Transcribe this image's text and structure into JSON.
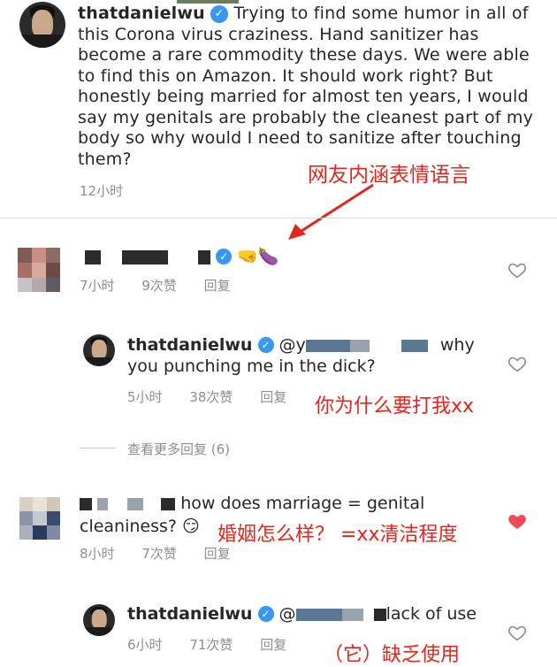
{
  "post": {
    "username": "thatdanielwu",
    "caption": "Trying to find some humor in all of this Corona virus craziness. Hand sanitizer has become a rare commodity these days. We were able to find this on Amazon. It should work right? But honestly being married for almost ten years, I would say my genitals are probably the cleanest part of my body so why would I need to sanitize after touching them?",
    "time": "12小时"
  },
  "annotations": {
    "emoji_note": "网友内涵表情语言",
    "reply1_note": "你为什么要打我xx",
    "comment2_note": "婚姻怎么样？ =xx清洁程度",
    "reply2_note": "（它）缺乏使用"
  },
  "comment1": {
    "emoji": "🤜🍆",
    "time": "7小时",
    "likes": "9次赞",
    "reply": "回复"
  },
  "reply1": {
    "username": "thatdanielwu",
    "mention_prefix": "@y",
    "text_after": "why",
    "text_line2": "you punching me in the dick?",
    "time": "5小时",
    "likes": "38次赞",
    "reply": "回复"
  },
  "view_more": "查看更多回复 (6)",
  "comment2": {
    "text_line1": "how does marriage = genital",
    "text_line2": "cleaniness? 😏",
    "time": "8小时",
    "likes": "7次赞",
    "reply": "回复",
    "liked": true
  },
  "reply2": {
    "username": "thatdanielwu",
    "mention_prefix": "@",
    "text_after": "lack of use",
    "time": "6小时",
    "likes": "71次赞",
    "reply": "回复"
  },
  "colors": {
    "accent_red": "#e0261d",
    "verified_blue": "#3897f0",
    "liked_heart": "#ed4956",
    "meta_grey": "#8e8e8e"
  },
  "icons": [
    "verified-badge-icon",
    "heart-outline-icon",
    "heart-filled-icon",
    "arrow-annotation-icon"
  ]
}
